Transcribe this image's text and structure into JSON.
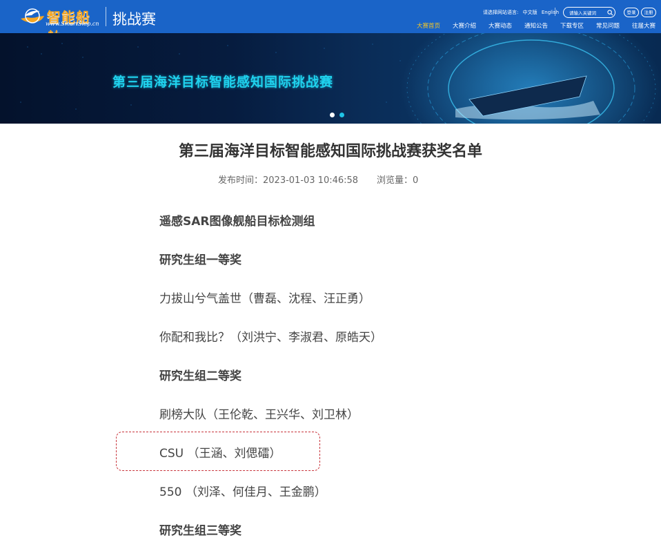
{
  "header": {
    "logo_cn": "智能船舶",
    "logo_en": "www.SmartShip.cn",
    "site_name": "挑战赛",
    "lang_prompt": "请选择网站语言:",
    "lang_cn": "中文版",
    "lang_en": "English",
    "search_placeholder": "请输入关键词",
    "login_label": "登录",
    "register_label": "注册",
    "nav_items": [
      "大赛首页",
      "大赛介绍",
      "大赛动态",
      "通知公告",
      "下载专区",
      "常见问题",
      "往届大赛"
    ],
    "active_nav": "大赛首页",
    "accent_color": "#1a64c8",
    "active_color": "#f5c623"
  },
  "banner": {
    "title": "第三届海洋目标智能感知国际挑战赛",
    "title_color": "#1fd2ee",
    "ship_label": "ELBRIKEEN",
    "carousel_count": 2,
    "carousel_active": 1
  },
  "article": {
    "title": "第三届海洋目标智能感知国际挑战赛获奖名单",
    "publish_label": "发布时间：2023-01-03 10:46:58",
    "views_label": "浏览量：0",
    "lines": [
      {
        "text": "遥感SAR图像舰船目标检测组",
        "bold": true
      },
      {
        "text": "研究生组一等奖",
        "bold": true
      },
      {
        "text": "力拔山兮气盖世（曹磊、沈程、汪正勇）",
        "bold": false
      },
      {
        "text": "你配和我比？（刘洪宁、李淑君、原皓天）",
        "bold": false
      },
      {
        "text": "研究生组二等奖",
        "bold": true
      },
      {
        "text": "刷榜大队（王伦乾、王兴华、刘卫林）",
        "bold": false
      },
      {
        "text": "CSU （王涵、刘偲礌）",
        "bold": false
      },
      {
        "text": "550 （刘泽、何佳月、王金鹏）",
        "bold": false
      },
      {
        "text": "研究生组三等奖",
        "bold": true
      }
    ],
    "highlight_color": "#c8333a"
  }
}
